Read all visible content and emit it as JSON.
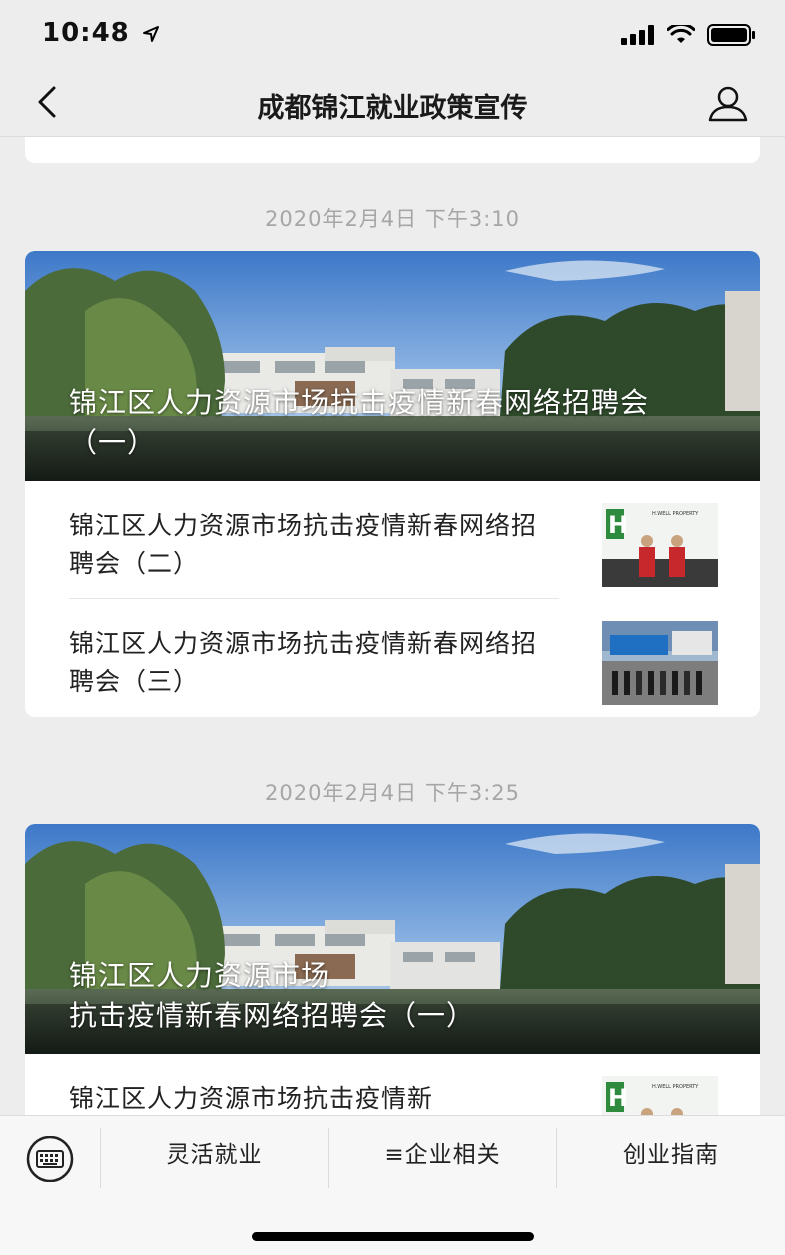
{
  "status_bar": {
    "time": "10:48"
  },
  "nav": {
    "title": "成都锦江就业政策宣传"
  },
  "sections": [
    {
      "timestamp": "2020年2月4日 下午3:10",
      "hero_title": "锦江区人力资源市场抗击疫情新春网络招聘会（一）",
      "items": [
        {
          "title": "锦江区人力资源市场抗击疫情新春网络招聘会（二）"
        },
        {
          "title": "锦江区人力资源市场抗击疫情新春网络招聘会（三）"
        }
      ]
    },
    {
      "timestamp": "2020年2月4日 下午3:25",
      "hero_title_line1": "锦江区人力资源市场",
      "hero_title_line2": "抗击疫情新春网络招聘会（一）",
      "items": [
        {
          "title": "锦江区人力资源市场抗击疫情新"
        }
      ]
    }
  ],
  "tabbar": {
    "tabs": [
      {
        "label": "灵活就业"
      },
      {
        "label": "≡企业相关"
      },
      {
        "label": "创业指南"
      }
    ]
  },
  "thumb_text": {
    "brand": "H.WELL PROPERTY"
  }
}
